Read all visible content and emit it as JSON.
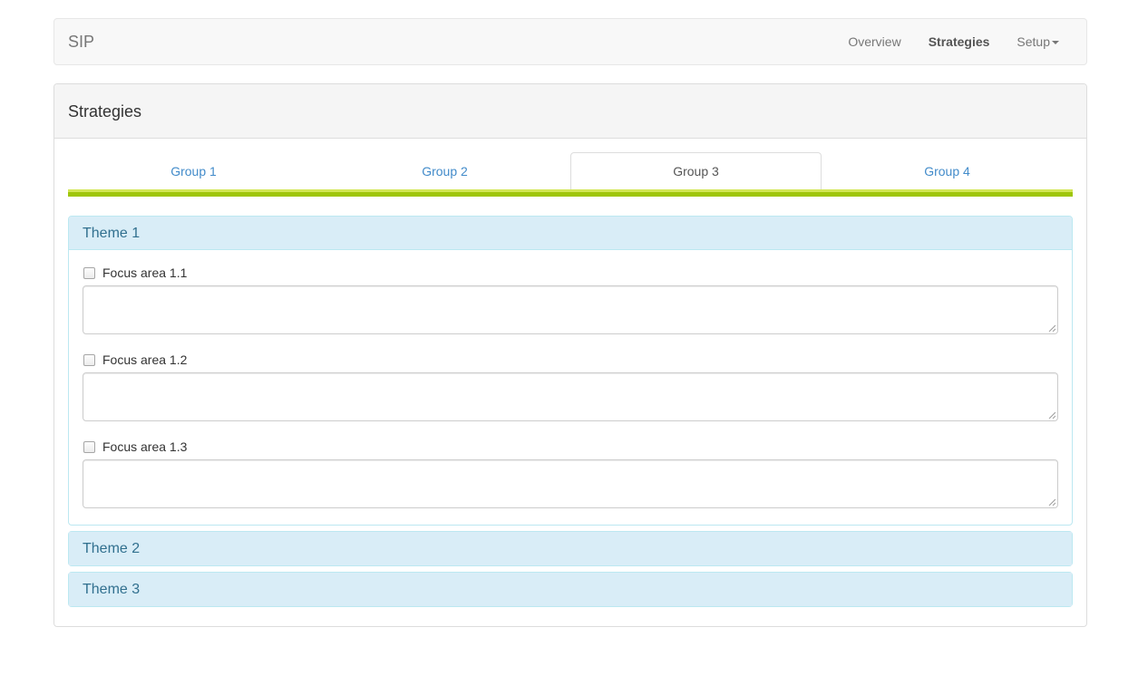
{
  "navbar": {
    "brand": "SIP",
    "items": [
      {
        "label": "Overview",
        "active": false
      },
      {
        "label": "Strategies",
        "active": true
      },
      {
        "label": "Setup",
        "active": false,
        "dropdown": true
      }
    ]
  },
  "panel": {
    "title": "Strategies"
  },
  "tabs": [
    {
      "label": "Group 1",
      "active": false
    },
    {
      "label": "Group 2",
      "active": false
    },
    {
      "label": "Group 3",
      "active": true
    },
    {
      "label": "Group 4",
      "active": false
    }
  ],
  "themes": [
    {
      "title": "Theme 1",
      "expanded": true,
      "focus_areas": [
        {
          "label": "Focus area 1.1",
          "checked": false,
          "value": ""
        },
        {
          "label": "Focus area 1.2",
          "checked": false,
          "value": ""
        },
        {
          "label": "Focus area 1.3",
          "checked": false,
          "value": ""
        }
      ]
    },
    {
      "title": "Theme 2",
      "expanded": false
    },
    {
      "title": "Theme 3",
      "expanded": false
    }
  ],
  "colors": {
    "tab_bar": "#9fc60b",
    "link": "#428bca",
    "theme_heading_bg": "#d9edf7",
    "theme_heading_text": "#31708f"
  }
}
